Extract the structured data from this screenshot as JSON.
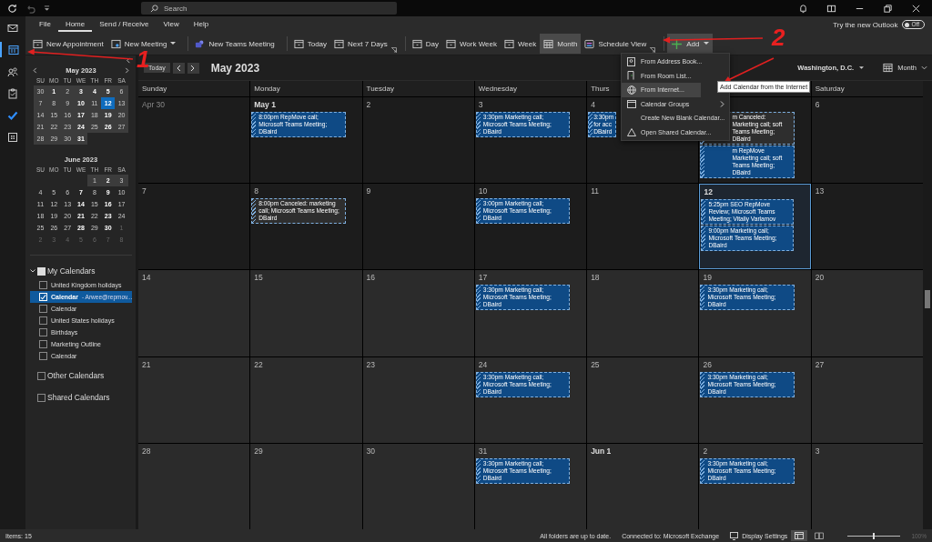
{
  "title_bar": {
    "search": {
      "placeholder": "Search"
    }
  },
  "nav": [
    {
      "kind": "mail",
      "selected": false
    },
    {
      "kind": "calendar",
      "selected": true
    },
    {
      "kind": "people",
      "selected": false
    },
    {
      "kind": "clipboard",
      "selected": false
    },
    {
      "kind": "check",
      "selected": false
    },
    {
      "kind": "apps",
      "selected": false
    }
  ],
  "tabs": [
    {
      "label": "File",
      "selected": false
    },
    {
      "label": "Home",
      "selected": true
    },
    {
      "label": "Send / Receive",
      "selected": false
    },
    {
      "label": "View",
      "selected": false
    },
    {
      "label": "Help",
      "selected": false
    }
  ],
  "new_outlook": {
    "label": "Try the new Outlook",
    "toggle": "Off",
    "on": false
  },
  "ribbon_groups": [
    {
      "launcher": false,
      "buttons": [
        {
          "label": "New Appointment",
          "kind": "calendar",
          "dropdown": false,
          "selected": false
        },
        {
          "label": "New Meeting",
          "kind": "meeting",
          "dropdown": true,
          "selected": false
        }
      ]
    },
    {
      "launcher": false,
      "buttons": [
        {
          "label": "New Teams Meeting",
          "kind": "teams",
          "dropdown": false,
          "selected": false
        }
      ]
    },
    {
      "launcher": true,
      "buttons": [
        {
          "label": "Today",
          "kind": "calendar",
          "dropdown": false,
          "selected": false
        },
        {
          "label": "Next 7 Days",
          "kind": "calendar",
          "dropdown": false,
          "selected": false
        }
      ]
    },
    {
      "launcher": true,
      "buttons": [
        {
          "label": "Day",
          "kind": "calendar",
          "dropdown": false,
          "selected": false
        },
        {
          "label": "Work Week",
          "kind": "calendar",
          "dropdown": false,
          "selected": false
        },
        {
          "label": "Week",
          "kind": "calendar",
          "dropdown": false,
          "selected": false
        },
        {
          "label": "Month",
          "kind": "grid",
          "dropdown": false,
          "selected": true
        },
        {
          "label": "Schedule View",
          "kind": "schedule",
          "dropdown": false,
          "selected": false
        }
      ]
    },
    {
      "launcher": false,
      "buttons": [
        {
          "label": "Add",
          "kind": "plus",
          "dropdown": true,
          "selected": true
        }
      ]
    }
  ],
  "mini_calendars": [
    {
      "title": "May 2023",
      "weekdays": [
        "SU",
        "MO",
        "TU",
        "WE",
        "TH",
        "FR",
        "SA"
      ],
      "weeks": [
        [
          {
            "label": "30",
            "bold": false,
            "in_view": true,
            "muted": false,
            "selected": false
          },
          {
            "label": "1",
            "bold": true,
            "in_view": true,
            "muted": false,
            "selected": false
          },
          {
            "label": "2",
            "bold": false,
            "in_view": true,
            "muted": false,
            "selected": false
          },
          {
            "label": "3",
            "bold": true,
            "in_view": true,
            "muted": false,
            "selected": false
          },
          {
            "label": "4",
            "bold": true,
            "in_view": true,
            "muted": false,
            "selected": false
          },
          {
            "label": "5",
            "bold": true,
            "in_view": true,
            "muted": false,
            "selected": false
          },
          {
            "label": "6",
            "bold": false,
            "in_view": true,
            "muted": false,
            "selected": false
          }
        ],
        [
          {
            "label": "7",
            "bold": false,
            "in_view": true,
            "muted": false,
            "selected": false
          },
          {
            "label": "8",
            "bold": false,
            "in_view": true,
            "muted": false,
            "selected": false
          },
          {
            "label": "9",
            "bold": false,
            "in_view": true,
            "muted": false,
            "selected": false
          },
          {
            "label": "10",
            "bold": true,
            "in_view": true,
            "muted": false,
            "selected": false
          },
          {
            "label": "11",
            "bold": false,
            "in_view": true,
            "muted": false,
            "selected": false
          },
          {
            "label": "12",
            "bold": true,
            "in_view": true,
            "muted": false,
            "selected": true
          },
          {
            "label": "13",
            "bold": false,
            "in_view": true,
            "muted": false,
            "selected": false
          }
        ],
        [
          {
            "label": "14",
            "bold": false,
            "in_view": true,
            "muted": false,
            "selected": false
          },
          {
            "label": "15",
            "bold": false,
            "in_view": true,
            "muted": false,
            "selected": false
          },
          {
            "label": "16",
            "bold": false,
            "in_view": true,
            "muted": false,
            "selected": false
          },
          {
            "label": "17",
            "bold": true,
            "in_view": true,
            "muted": false,
            "selected": false
          },
          {
            "label": "18",
            "bold": false,
            "in_view": true,
            "muted": false,
            "selected": false
          },
          {
            "label": "19",
            "bold": true,
            "in_view": true,
            "muted": false,
            "selected": false
          },
          {
            "label": "20",
            "bold": false,
            "in_view": true,
            "muted": false,
            "selected": false
          }
        ],
        [
          {
            "label": "21",
            "bold": false,
            "in_view": true,
            "muted": false,
            "selected": false
          },
          {
            "label": "22",
            "bold": false,
            "in_view": true,
            "muted": false,
            "selected": false
          },
          {
            "label": "23",
            "bold": false,
            "in_view": true,
            "muted": false,
            "selected": false
          },
          {
            "label": "24",
            "bold": true,
            "in_view": true,
            "muted": false,
            "selected": false
          },
          {
            "label": "25",
            "bold": false,
            "in_view": true,
            "muted": false,
            "selected": false
          },
          {
            "label": "26",
            "bold": true,
            "in_view": true,
            "muted": false,
            "selected": false
          },
          {
            "label": "27",
            "bold": false,
            "in_view": true,
            "muted": false,
            "selected": false
          }
        ],
        [
          {
            "label": "28",
            "bold": false,
            "in_view": true,
            "muted": false,
            "selected": false
          },
          {
            "label": "29",
            "bold": false,
            "in_view": true,
            "muted": false,
            "selected": false
          },
          {
            "label": "30",
            "bold": false,
            "in_view": true,
            "muted": false,
            "selected": false
          },
          {
            "label": "31",
            "bold": true,
            "in_view": true,
            "muted": false,
            "selected": false
          }
        ]
      ]
    },
    {
      "title": "June 2023",
      "weekdays": [
        "SU",
        "MO",
        "TU",
        "WE",
        "TH",
        "FR",
        "SA"
      ],
      "weeks": [
        [
          {
            "label": "1",
            "bold": false,
            "in_view": true,
            "muted": false,
            "selected": false
          },
          {
            "label": "2",
            "bold": true,
            "in_view": true,
            "muted": false,
            "selected": false
          },
          {
            "label": "3",
            "bold": false,
            "in_view": true,
            "muted": false,
            "selected": false
          }
        ],
        [
          {
            "label": "4",
            "bold": false,
            "in_view": false,
            "muted": false,
            "selected": false
          },
          {
            "label": "5",
            "bold": false,
            "in_view": false,
            "muted": false,
            "selected": false
          },
          {
            "label": "6",
            "bold": false,
            "in_view": false,
            "muted": false,
            "selected": false
          },
          {
            "label": "7",
            "bold": true,
            "in_view": false,
            "muted": false,
            "selected": false
          },
          {
            "label": "8",
            "bold": false,
            "in_view": false,
            "muted": false,
            "selected": false
          },
          {
            "label": "9",
            "bold": true,
            "in_view": false,
            "muted": false,
            "selected": false
          },
          {
            "label": "10",
            "bold": false,
            "in_view": false,
            "muted": false,
            "selected": false
          }
        ],
        [
          {
            "label": "11",
            "bold": false,
            "in_view": false,
            "muted": false,
            "selected": false
          },
          {
            "label": "12",
            "bold": false,
            "in_view": false,
            "muted": false,
            "selected": false
          },
          {
            "label": "13",
            "bold": false,
            "in_view": false,
            "muted": false,
            "selected": false
          },
          {
            "label": "14",
            "bold": true,
            "in_view": false,
            "muted": false,
            "selected": false
          },
          {
            "label": "15",
            "bold": false,
            "in_view": false,
            "muted": false,
            "selected": false
          },
          {
            "label": "16",
            "bold": true,
            "in_view": false,
            "muted": false,
            "selected": false
          },
          {
            "label": "17",
            "bold": false,
            "in_view": false,
            "muted": false,
            "selected": false
          }
        ],
        [
          {
            "label": "18",
            "bold": false,
            "in_view": false,
            "muted": false,
            "selected": false
          },
          {
            "label": "19",
            "bold": false,
            "in_view": false,
            "muted": false,
            "selected": false
          },
          {
            "label": "20",
            "bold": false,
            "in_view": false,
            "muted": false,
            "selected": false
          },
          {
            "label": "21",
            "bold": true,
            "in_view": false,
            "muted": false,
            "selected": false
          },
          {
            "label": "22",
            "bold": false,
            "in_view": false,
            "muted": false,
            "selected": false
          },
          {
            "label": "23",
            "bold": true,
            "in_view": false,
            "muted": false,
            "selected": false
          },
          {
            "label": "24",
            "bold": false,
            "in_view": false,
            "muted": false,
            "selected": false
          }
        ],
        [
          {
            "label": "25",
            "bold": false,
            "in_view": false,
            "muted": false,
            "selected": false
          },
          {
            "label": "26",
            "bold": false,
            "in_view": false,
            "muted": false,
            "selected": false
          },
          {
            "label": "27",
            "bold": false,
            "in_view": false,
            "muted": false,
            "selected": false
          },
          {
            "label": "28",
            "bold": true,
            "in_view": false,
            "muted": false,
            "selected": false
          },
          {
            "label": "29",
            "bold": false,
            "in_view": false,
            "muted": false,
            "selected": false
          },
          {
            "label": "30",
            "bold": true,
            "in_view": false,
            "muted": false,
            "selected": false
          },
          {
            "label": "1",
            "bold": false,
            "in_view": false,
            "muted": true,
            "selected": false
          }
        ],
        [
          {
            "label": "2",
            "bold": false,
            "in_view": false,
            "muted": true,
            "selected": false
          },
          {
            "label": "3",
            "bold": false,
            "in_view": false,
            "muted": true,
            "selected": false
          },
          {
            "label": "4",
            "bold": false,
            "in_view": false,
            "muted": true,
            "selected": false
          },
          {
            "label": "5",
            "bold": false,
            "in_view": false,
            "muted": true,
            "selected": false
          },
          {
            "label": "6",
            "bold": false,
            "in_view": false,
            "muted": true,
            "selected": false
          },
          {
            "label": "7",
            "bold": false,
            "in_view": false,
            "muted": true,
            "selected": false
          },
          {
            "label": "8",
            "bold": false,
            "in_view": false,
            "muted": true,
            "selected": false
          }
        ]
      ]
    }
  ],
  "folders": [
    {
      "label": "My Calendars",
      "checked": true,
      "expanded": true,
      "items": [
        {
          "label": "United Kingdom holidays",
          "checked": false,
          "selected": false
        },
        {
          "label": "Calendar",
          "owner": "- Arwee@repmov...",
          "checked": true,
          "selected": true
        },
        {
          "label": "Calendar",
          "checked": false,
          "selected": false
        },
        {
          "label": "United States holidays",
          "checked": false,
          "selected": false
        },
        {
          "label": "Birthdays",
          "checked": false,
          "selected": false
        },
        {
          "label": "Marketing Outline",
          "checked": false,
          "selected": false
        },
        {
          "label": "Calendar",
          "checked": false,
          "selected": false
        }
      ]
    },
    {
      "label": "Other Calendars",
      "checked": false
    },
    {
      "label": "Shared Calendars",
      "checked": false
    }
  ],
  "calendar": {
    "today_button": "Today",
    "title": "May 2023",
    "location": "Washington, D.C.",
    "view": "Month",
    "weekdays": [
      "Sunday",
      "Monday",
      "Tuesday",
      "Wednesday",
      "Thurs",
      "Saturday"
    ],
    "weeks": [
      {
        "darker": true,
        "days": [
          {
            "label": "Apr 30",
            "bold": false,
            "muted": true,
            "today": false
          },
          {
            "label": "May 1",
            "bold": true,
            "muted": false,
            "today": false,
            "events": [
              {
                "text": "8:00pm RepMove call; Microsoft Teams Meeting; DBaird",
                "canceled": false,
                "kind": "whole"
              }
            ]
          },
          {
            "label": "2",
            "bold": false,
            "muted": false,
            "today": false
          },
          {
            "label": "3",
            "bold": false,
            "muted": false,
            "today": false,
            "events": [
              {
                "text": "3:30pm Marketing call; Microsoft Teams Meeting; DBaird",
                "canceled": false,
                "kind": "whole"
              }
            ]
          },
          {
            "label": "4",
            "bold": false,
            "muted": false,
            "today": false,
            "events": [
              {
                "text": "3:30pm for acc DBaird",
                "canceled": false,
                "kind": "head"
              }
            ]
          },
          {
            "bold": false,
            "muted": false,
            "today": false,
            "events": [
              {
                "text": "m Canceled: Marketing call; soft Teams Meeting; DBaird",
                "canceled": true,
                "kind": "tail"
              },
              {
                "text": "m RepMove Marketing call; soft Teams Meeting; DBaird",
                "canceled": false,
                "kind": "tail"
              }
            ]
          },
          {
            "label": "6",
            "bold": false,
            "muted": false,
            "today": false
          }
        ]
      },
      {
        "darker": true,
        "days": [
          {
            "label": "7",
            "bold": false,
            "muted": false,
            "today": false
          },
          {
            "label": "8",
            "bold": false,
            "muted": false,
            "today": false,
            "events": [
              {
                "text": "8:00pm Canceled: marketing call; Microsoft Teams Meeting; DBaird",
                "canceled": true,
                "kind": "whole"
              }
            ]
          },
          {
            "label": "9",
            "bold": false,
            "muted": false,
            "today": false
          },
          {
            "label": "10",
            "bold": false,
            "muted": false,
            "today": false,
            "events": [
              {
                "text": "3:00pm Marketing call; Microsoft Teams Meeting; DBaird",
                "canceled": false,
                "kind": "whole"
              }
            ]
          },
          {
            "label": "11",
            "bold": false,
            "muted": false,
            "today": false
          },
          {
            "label": "12",
            "bold": true,
            "muted": false,
            "today": true,
            "events": [
              {
                "text": "5:25pm SEO RepMove Review; Microsoft Teams Meeting; Vitaliy Varlamov",
                "canceled": false,
                "kind": "whole"
              },
              {
                "text": "9:00pm Marketing call; Microsoft Teams Meeting; DBaird",
                "canceled": false,
                "kind": "whole"
              }
            ]
          },
          {
            "label": "13",
            "bold": false,
            "muted": false,
            "today": false
          }
        ]
      },
      {
        "darker": false,
        "days": [
          {
            "label": "14",
            "bold": false,
            "muted": false,
            "today": false
          },
          {
            "label": "15",
            "bold": false,
            "muted": false,
            "today": false
          },
          {
            "label": "16",
            "bold": false,
            "muted": false,
            "today": false
          },
          {
            "label": "17",
            "bold": false,
            "muted": false,
            "today": false,
            "events": [
              {
                "text": "3:30pm Marketing call; Microsoft Teams Meeting; DBaird",
                "canceled": false,
                "kind": "whole"
              }
            ]
          },
          {
            "label": "18",
            "bold": false,
            "muted": false,
            "today": false
          },
          {
            "label": "19",
            "bold": false,
            "muted": false,
            "today": false,
            "events": [
              {
                "text": "3:30pm Marketing call; Microsoft Teams Meeting; DBaird",
                "canceled": false,
                "kind": "whole"
              }
            ]
          },
          {
            "label": "20",
            "bold": false,
            "muted": false,
            "today": false
          }
        ]
      },
      {
        "darker": false,
        "days": [
          {
            "label": "21",
            "bold": false,
            "muted": false,
            "today": false
          },
          {
            "label": "22",
            "bold": false,
            "muted": false,
            "today": false
          },
          {
            "label": "23",
            "bold": false,
            "muted": false,
            "today": false
          },
          {
            "label": "24",
            "bold": false,
            "muted": false,
            "today": false,
            "events": [
              {
                "text": "3:30pm Marketing call; Microsoft Teams Meeting; DBaird",
                "canceled": false,
                "kind": "whole"
              }
            ]
          },
          {
            "label": "25",
            "bold": false,
            "muted": false,
            "today": false
          },
          {
            "label": "26",
            "bold": false,
            "muted": false,
            "today": false,
            "events": [
              {
                "text": "3:30pm Marketing call; Microsoft Teams Meeting; DBaird",
                "canceled": false,
                "kind": "whole"
              }
            ]
          },
          {
            "label": "27",
            "bold": false,
            "muted": false,
            "today": false
          }
        ]
      },
      {
        "darker": false,
        "days": [
          {
            "label": "28",
            "bold": false,
            "muted": false,
            "today": false
          },
          {
            "label": "29",
            "bold": false,
            "muted": false,
            "today": false
          },
          {
            "label": "30",
            "bold": false,
            "muted": false,
            "today": false
          },
          {
            "label": "31",
            "bold": false,
            "muted": false,
            "today": false,
            "events": [
              {
                "text": "3:30pm Marketing call; Microsoft Teams Meeting; DBaird",
                "canceled": false,
                "kind": "whole"
              }
            ]
          },
          {
            "label": "Jun 1",
            "bold": true,
            "muted": false,
            "today": false
          },
          {
            "label": "2",
            "bold": false,
            "muted": false,
            "today": false,
            "events": [
              {
                "text": "3:30pm Marketing call; Microsoft Teams Meeting; DBaird",
                "canceled": false,
                "kind": "whole"
              }
            ]
          },
          {
            "label": "3",
            "bold": false,
            "muted": false,
            "today": false
          }
        ]
      }
    ]
  },
  "add_menu": {
    "items": [
      {
        "label": "From Address Book...",
        "kind": "book",
        "selected": false,
        "submenu": false
      },
      {
        "label": "From Room List...",
        "kind": "room",
        "selected": false,
        "submenu": false
      },
      {
        "label": "From Internet...",
        "kind": "globe",
        "selected": true,
        "submenu": false
      },
      {
        "label": "Calendar Groups",
        "kind": "folder",
        "selected": false,
        "submenu": true
      },
      {
        "label": "Create New Blank Calendar...",
        "kind": "plain",
        "selected": false,
        "submenu": false
      },
      {
        "label": "Open Shared Calendar...",
        "kind": "shared",
        "selected": false,
        "submenu": false
      }
    ]
  },
  "tooltip": "Add Calendar from the Internet",
  "annotations": [
    "1",
    "2"
  ],
  "status_bar": {
    "items": "Items: 15",
    "sync": "All folders are up to date.",
    "connection": "Connected to: Microsoft Exchange",
    "display_settings": "Display Settings",
    "zoom": {
      "level": 0.5,
      "reading": "100%"
    }
  }
}
